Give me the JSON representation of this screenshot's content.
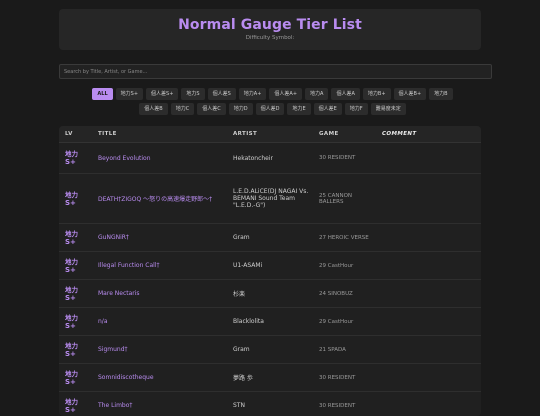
{
  "header": {
    "title": "Normal Gauge Tier List",
    "subtitle": "Difficulty Symbol:"
  },
  "search": {
    "placeholder": "Search by Title, Artist, or Game..."
  },
  "filters": {
    "row1": [
      "ALL",
      "地力S+",
      "個人差S+",
      "地力S",
      "個人差S",
      "地力A+",
      "個人差A+",
      "地力A",
      "個人差A",
      "地力B+",
      "個人差B+",
      "地力B"
    ],
    "row2": [
      "個人差B",
      "地力C",
      "個人差C",
      "地力D",
      "個人差D",
      "地力E",
      "個人差E",
      "地力F",
      "難易度未定"
    ]
  },
  "table": {
    "headers": {
      "lv": "LV",
      "title": "TITLE",
      "artist": "ARTIST",
      "game": "GAME",
      "comment": "COMMENT"
    },
    "rows": [
      {
        "lv1": "地力",
        "lv2": "S+",
        "title": "Beyond Evolution",
        "artist": "Hekatoncheir",
        "game": "30 RESIDENT"
      },
      {
        "lv1": "地力",
        "lv2": "S+",
        "title": "DEATH†ZIGOQ ～怒りの高速爆走野郎～†",
        "artist": "L.E.D.ALiCE(DJ NAGAI Vs. BEMANI Sound Team \"L.E.D.-G\")",
        "game": "25 CANNON BALLERS"
      },
      {
        "lv1": "地力",
        "lv2": "S+",
        "title": "GuNGNiR†",
        "artist": "Gram",
        "game": "27 HEROIC VERSE"
      },
      {
        "lv1": "地力",
        "lv2": "S+",
        "title": "Illegal Function Call†",
        "artist": "U1-ASAMi",
        "game": "29 CastHour"
      },
      {
        "lv1": "地力",
        "lv2": "S+",
        "title": "Mare Nectaris",
        "artist": "杉楽",
        "game": "24 SINOBUZ"
      },
      {
        "lv1": "地力",
        "lv2": "S+",
        "title": "n/a",
        "artist": "Blacklolita",
        "game": "29 CastHour"
      },
      {
        "lv1": "地力",
        "lv2": "S+",
        "title": "Sigmund†",
        "artist": "Gram",
        "game": "21 SPADA"
      },
      {
        "lv1": "地力",
        "lv2": "S+",
        "title": "Somnidiscotheque",
        "artist": "夢路 歩",
        "game": "30 RESIDENT"
      },
      {
        "lv1": "地力",
        "lv2": "S+",
        "title": "The Limbo†",
        "artist": "STN",
        "game": "30 RESIDENT"
      }
    ]
  }
}
